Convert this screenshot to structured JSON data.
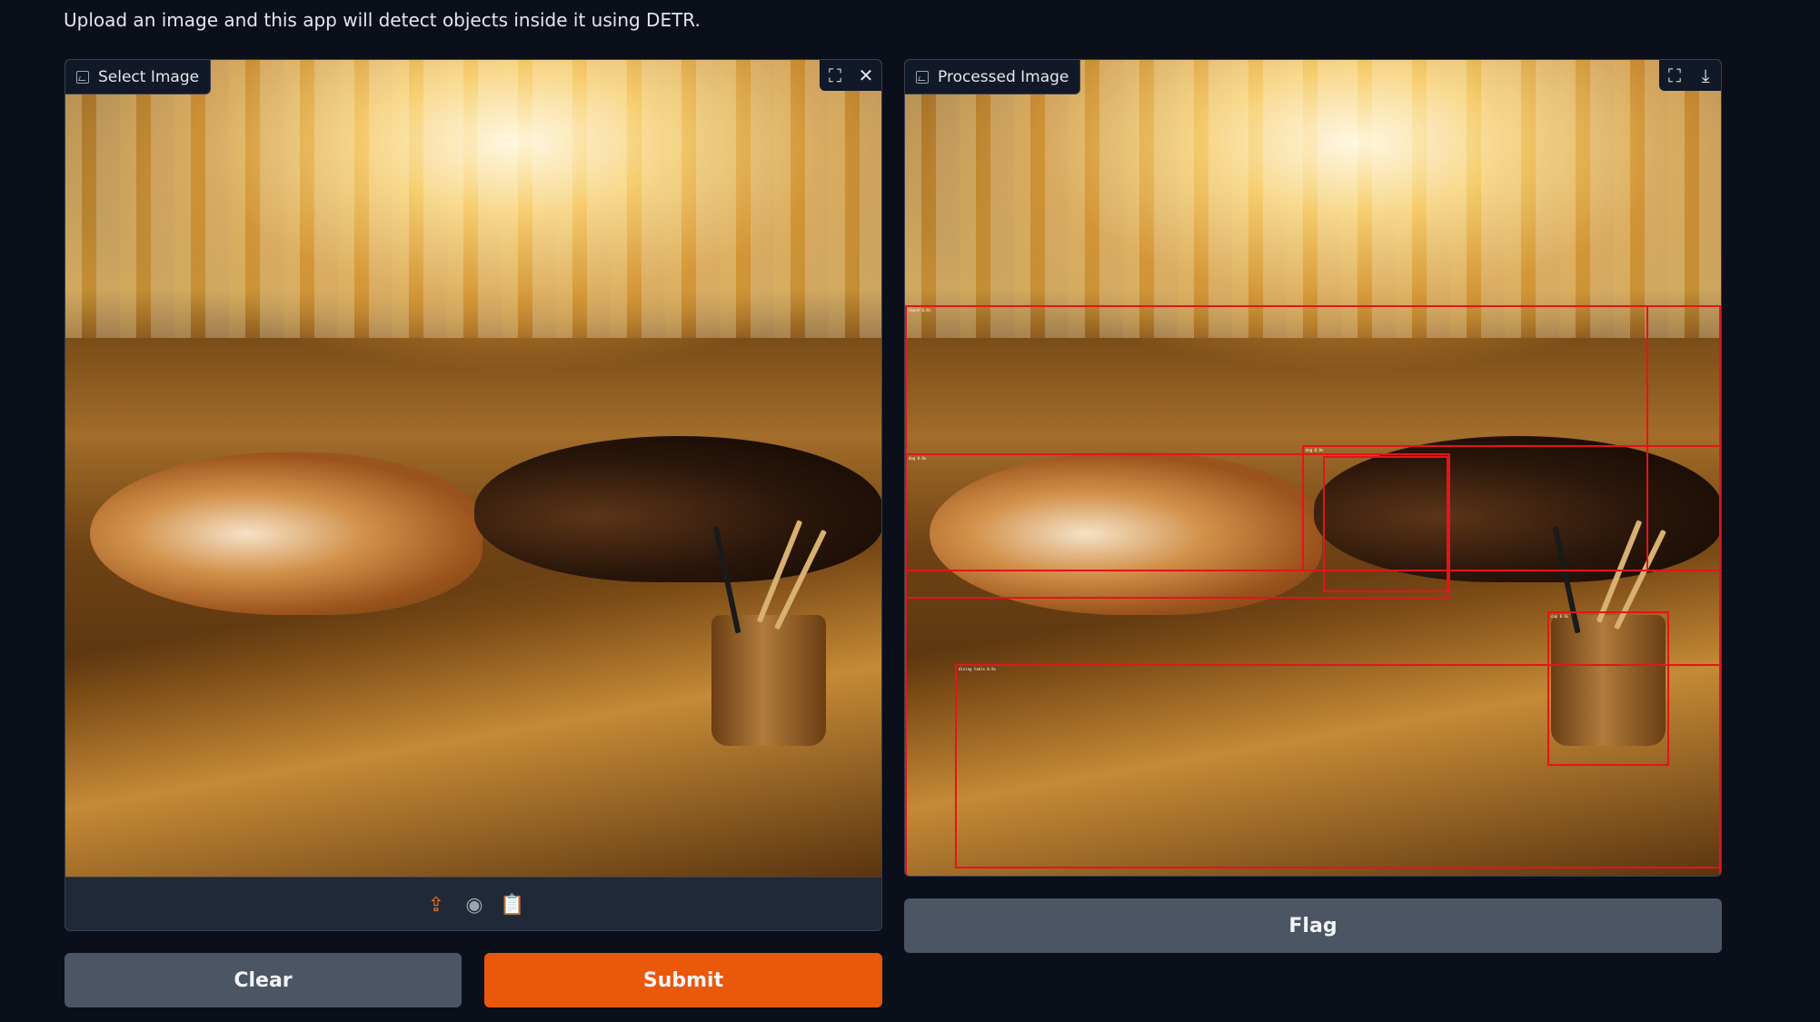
{
  "description": "Upload an image and this app will detect objects inside it using DETR.",
  "input_panel": {
    "label": "Select Image",
    "label_icon": "image-icon",
    "tools": [
      "fullscreen-icon",
      "close-icon"
    ],
    "sources": [
      "upload-icon",
      "webcam-icon",
      "clipboard-icon"
    ],
    "active_source": "upload"
  },
  "output_panel": {
    "label": "Processed Image",
    "label_icon": "image-icon",
    "tools": [
      "fullscreen-icon",
      "download-icon"
    ],
    "detections": [
      {
        "label": "couch 0.9x"
      },
      {
        "label": "dog 0.9x"
      },
      {
        "label": "dog 0.9x"
      },
      {
        "label": "cup 0.9x"
      },
      {
        "label": "dining table 0.9x"
      }
    ],
    "box_color": "#e5141b"
  },
  "buttons": {
    "clear": "Clear",
    "submit": "Submit",
    "flag": "Flag"
  },
  "colors": {
    "primary": "#ea580c",
    "secondary": "#4b5563",
    "background": "#0b0f19"
  }
}
